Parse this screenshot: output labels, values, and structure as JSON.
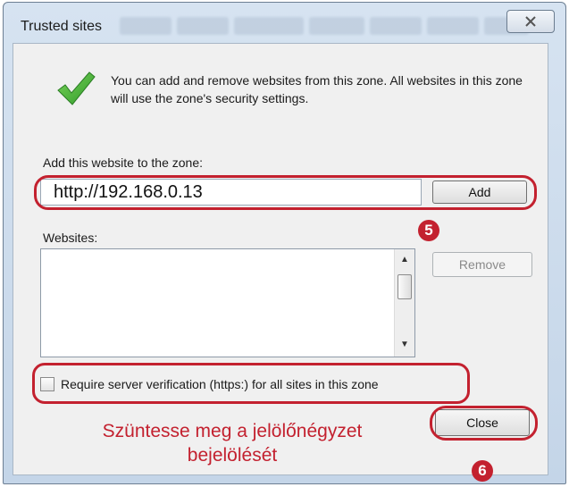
{
  "window": {
    "title": "Trusted sites",
    "close_glyph": "✕"
  },
  "info": {
    "icon": "green-checkmark-icon",
    "text": "You can add and remove websites from this zone. All websites in this zone will use the zone's security settings."
  },
  "add_section": {
    "label": "Add this website to the zone:",
    "url_value": "http://192.168.0.13",
    "add_button": "Add"
  },
  "websites": {
    "label": "Websites:",
    "items": [],
    "remove_button": "Remove"
  },
  "require_https": {
    "label": "Require server verification (https:) for all sites in this zone",
    "checked": false
  },
  "close_button": "Close",
  "annotations": {
    "step5": "5",
    "step6": "6",
    "instruction_line1": "Szüntesse meg a jelölőnégyzet",
    "instruction_line2": "bejelölését",
    "color": "#c3212f"
  }
}
